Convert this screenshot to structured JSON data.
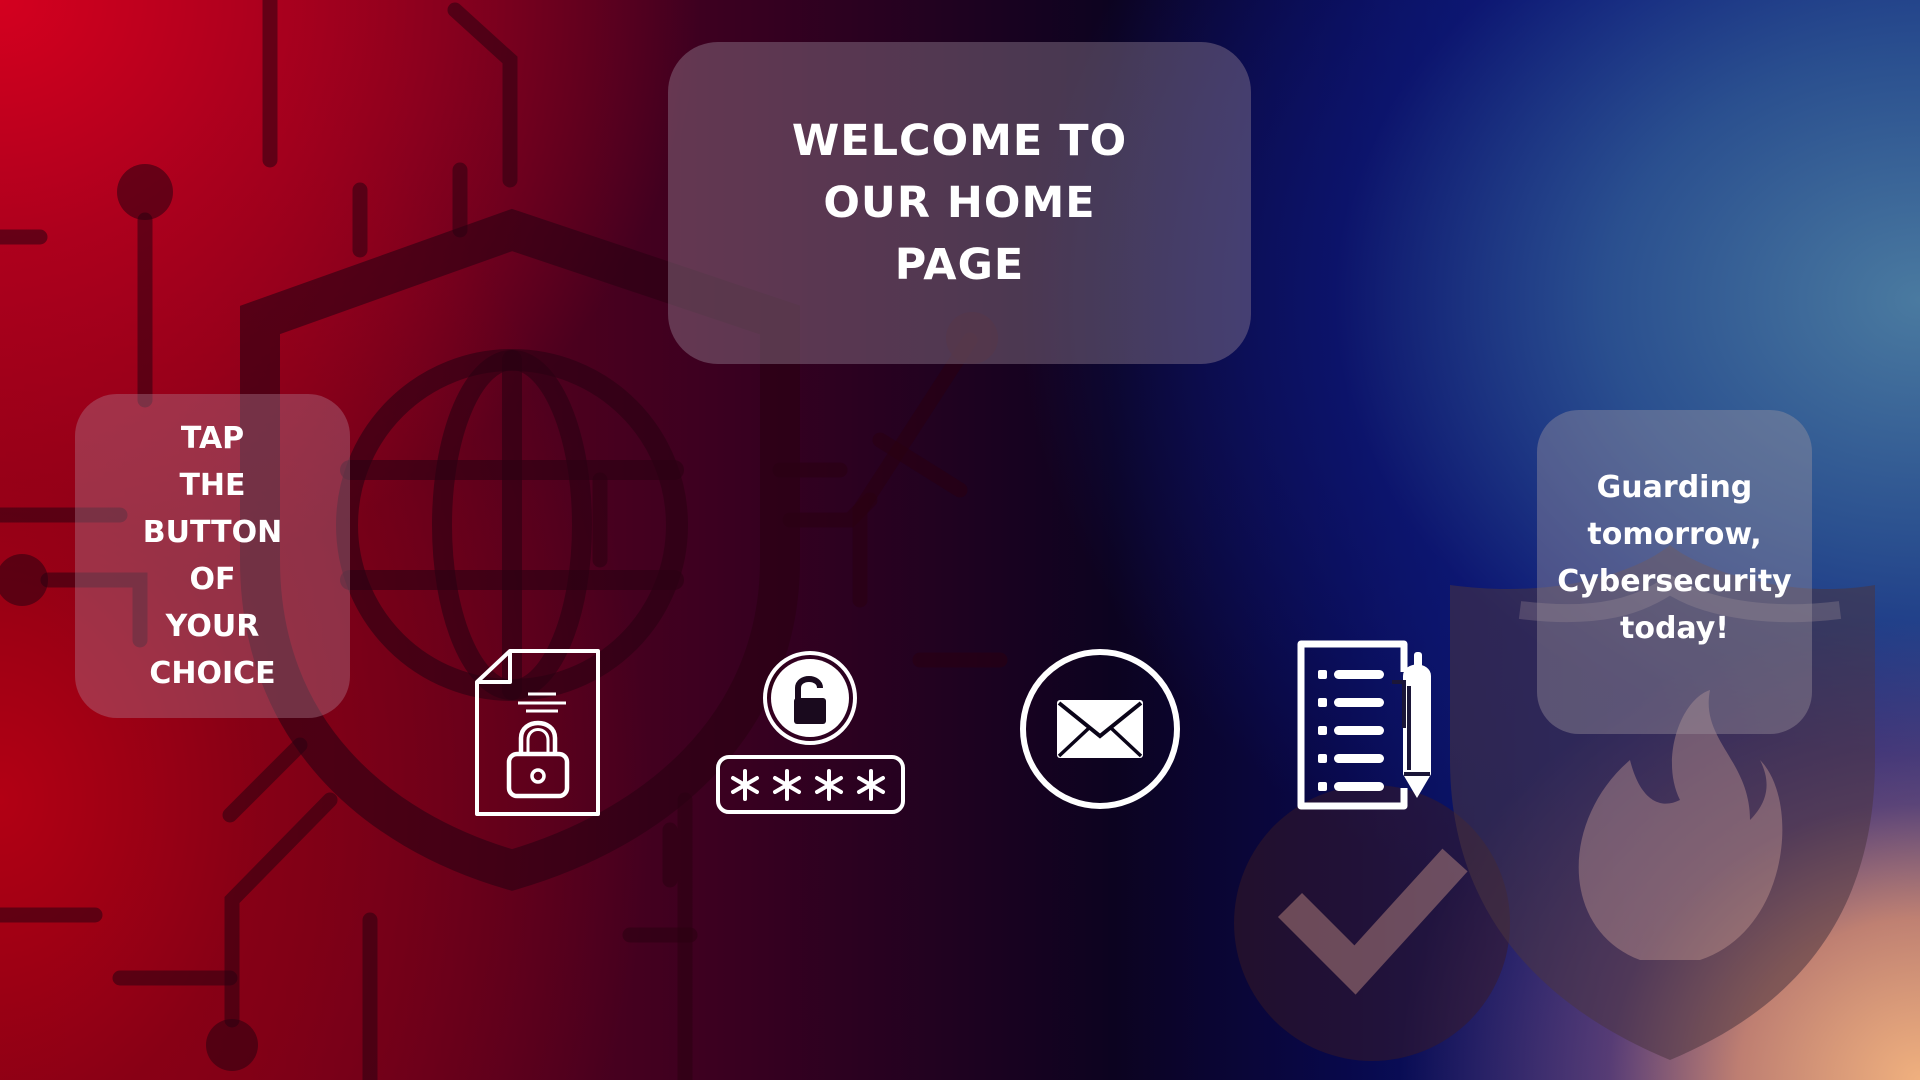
{
  "welcome": {
    "text": "WELCOME TO\nOUR HOME\nPAGE"
  },
  "instructions": {
    "text": "TAP\n THE\nBUTTON\nOF\n YOUR\nCHOICE"
  },
  "slogan": {
    "text": "Guarding\ntomorrow,\nCybersecurity\ntoday!"
  },
  "buttons": [
    {
      "name": "file-lock-button",
      "icon": "file-lock-icon"
    },
    {
      "name": "password-button",
      "icon": "password-lock-icon"
    },
    {
      "name": "mail-button",
      "icon": "envelope-icon"
    },
    {
      "name": "document-button",
      "icon": "document-pen-icon"
    }
  ],
  "colors": {
    "panel": "#9c8696",
    "icon": "#ffffff",
    "background_left": "#d4001f",
    "background_center": "#0c0320",
    "background_right": "#1e4c92",
    "background_corner": "#f0b07e"
  }
}
